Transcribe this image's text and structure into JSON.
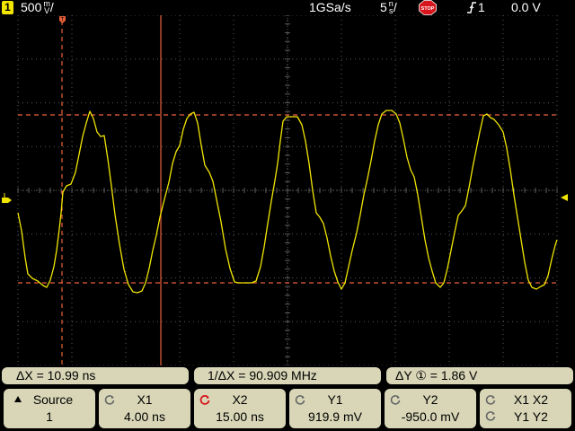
{
  "topbar": {
    "channel_number": "1",
    "volts_value": "500",
    "volts_unit_top": "m",
    "volts_unit_bottom": "V",
    "sample_rate": "1GSa/s",
    "time_value": "5",
    "time_unit_top": "n",
    "time_unit_bottom": "s",
    "stop_label": "STOP",
    "trigger_source": "1",
    "trigger_level": "0.0 V"
  },
  "status": {
    "delta_x": "ΔX = 10.99 ns",
    "inv_delta_x": "1/ΔX = 90.909 MHz",
    "delta_y_prefix": "ΔY",
    "delta_y_channel": "①",
    "delta_y_value": "=  1.86  V"
  },
  "softkeys": {
    "source_label": "Source",
    "source_value": "1",
    "x1_label": "X1",
    "x1_value": "4.00 ns",
    "x2_label": "X2",
    "x2_value": "15.00 ns",
    "y1_label": "Y1",
    "y1_value": "919.9 mV",
    "y2_label": "Y2",
    "y2_value": "-950.0 mV",
    "xx_label": "X1  X2",
    "yy_label": "Y1  Y2"
  },
  "colors": {
    "trace": "#f2e600",
    "cursor": "#e8603a",
    "grid": "#5a5a5a",
    "key_bg": "#d8d6b7"
  }
}
